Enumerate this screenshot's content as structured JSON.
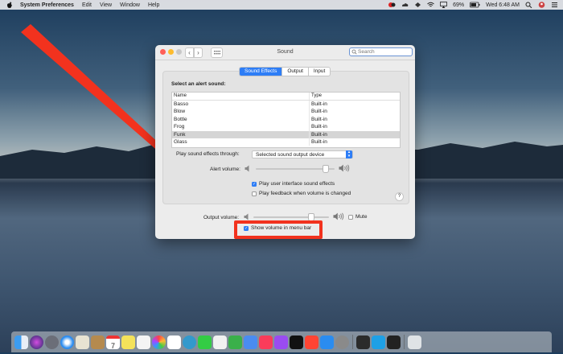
{
  "menubar": {
    "app_name": "System Preferences",
    "menus": [
      "Edit",
      "View",
      "Window",
      "Help"
    ],
    "battery": "69%",
    "clock": "Wed 6:48 AM"
  },
  "window": {
    "title": "Sound",
    "back_glyph": "‹",
    "forward_glyph": "›",
    "search_placeholder": "Search",
    "tabs": [
      {
        "label": "Sound Effects",
        "active": true
      },
      {
        "label": "Output",
        "active": false
      },
      {
        "label": "Input",
        "active": false
      }
    ],
    "select_alert_label": "Select an alert sound:",
    "table": {
      "headers": [
        "Name",
        "Type"
      ],
      "rows": [
        {
          "name": "Basso",
          "type": "Built-in"
        },
        {
          "name": "Blow",
          "type": "Built-in"
        },
        {
          "name": "Bottle",
          "type": "Built-in"
        },
        {
          "name": "Frog",
          "type": "Built-in"
        },
        {
          "name": "Funk",
          "type": "Built-in",
          "selected": true
        },
        {
          "name": "Glass",
          "type": "Built-in"
        }
      ]
    },
    "play_through_label": "Play sound effects through:",
    "play_through_value": "Selected sound output device",
    "alert_volume_label": "Alert volume:",
    "alert_volume_level": 0.88,
    "play_ui_effects_label": "Play user interface sound effects",
    "play_ui_effects_checked": true,
    "play_feedback_label": "Play feedback when volume is changed",
    "play_feedback_checked": false,
    "help_glyph": "?",
    "output_volume_label": "Output volume:",
    "output_volume_level": 0.75,
    "mute_label": "Mute",
    "mute_checked": false,
    "show_volume_label": "Show volume in menu bar",
    "show_volume_checked": true
  },
  "colors": {
    "accent": "#2d7df6",
    "annotation_red": "#f2321e"
  },
  "dock": {
    "icons": [
      "finder-icon",
      "siri-icon",
      "launchpad-icon",
      "safari-icon",
      "mail-icon",
      "notes-icon",
      "calendar-icon",
      "stickies-icon",
      "reminders-icon",
      "photos-icon",
      "slack-icon",
      "messages-icon",
      "facetime-icon",
      "itunes-icon",
      "numbers-icon",
      "keynote-icon",
      "music-icon",
      "podcasts-icon",
      "appletv-icon",
      "news-icon",
      "app-store-icon",
      "system-preferences-icon",
      "acrobat-icon",
      "skype-icon",
      "terminal-icon",
      "trash-icon"
    ],
    "calendar_day": "7"
  }
}
